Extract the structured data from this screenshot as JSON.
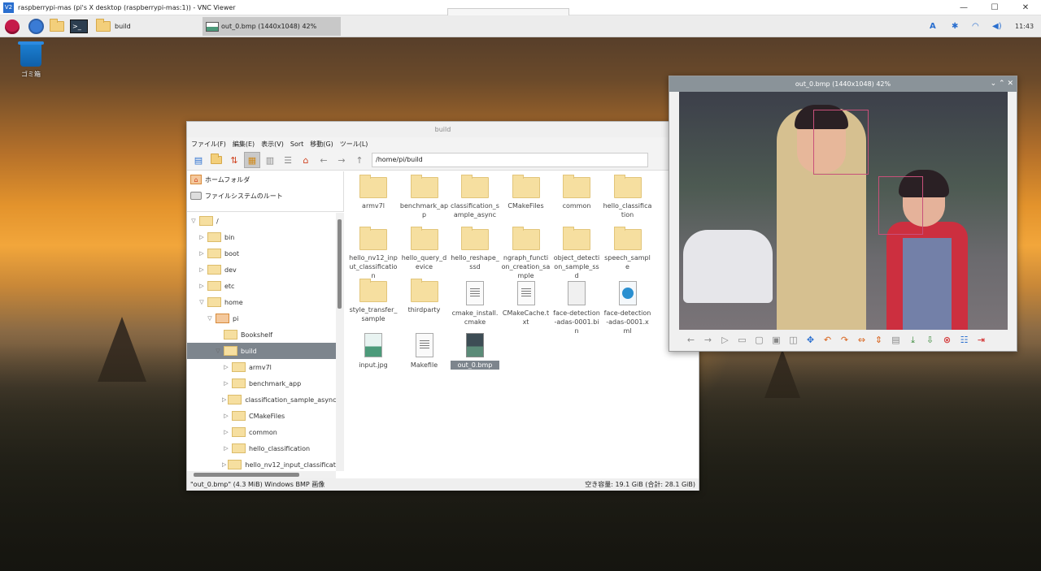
{
  "vnc": {
    "title": "raspberrypi-mas (pi's X desktop (raspberrypi-mas:1)) - VNC Viewer",
    "icon_text": "V2",
    "minimize": "—",
    "maximize": "☐",
    "close": "✕"
  },
  "taskbar": {
    "task_build": "build",
    "task_viewer": "out_0.bmp (1440x1048) 42%",
    "lang": "A",
    "clock": "11:43"
  },
  "desktop": {
    "trash_label": "ゴミ箱"
  },
  "fm": {
    "title": "build",
    "menu": [
      "ファイル(F)",
      "編集(E)",
      "表示(V)",
      "Sort",
      "移動(G)",
      "ツール(L)"
    ],
    "path": "/home/pi/build",
    "places": [
      "ホームフォルダ",
      "ファイルシステムのルート"
    ],
    "tree": [
      {
        "label": "/",
        "expanded": true
      },
      {
        "label": "bin"
      },
      {
        "label": "boot"
      },
      {
        "label": "dev"
      },
      {
        "label": "etc"
      },
      {
        "label": "home",
        "expanded": true
      },
      {
        "label": "pi",
        "expanded": true
      },
      {
        "label": "Bookshelf"
      },
      {
        "label": "build",
        "expanded": true,
        "selected": true
      },
      {
        "label": "armv7l"
      },
      {
        "label": "benchmark_app"
      },
      {
        "label": "classification_sample_async"
      },
      {
        "label": "CMakeFiles"
      },
      {
        "label": "common"
      },
      {
        "label": "hello_classification"
      },
      {
        "label": "hello_nv12_input_classificatic"
      }
    ],
    "files": [
      {
        "name": "armv7l",
        "type": "folder"
      },
      {
        "name": "benchmark_app",
        "type": "folder"
      },
      {
        "name": "classification_sample_async",
        "type": "folder"
      },
      {
        "name": "CMakeFiles",
        "type": "folder"
      },
      {
        "name": "common",
        "type": "folder"
      },
      {
        "name": "hello_classification",
        "type": "folder"
      },
      {
        "name": "hello_nv12_input_classification",
        "type": "folder"
      },
      {
        "name": "hello_query_device",
        "type": "folder"
      },
      {
        "name": "hello_reshape_ssd",
        "type": "folder"
      },
      {
        "name": "ngraph_function_creation_sample",
        "type": "folder"
      },
      {
        "name": "object_detection_sample_ssd",
        "type": "folder"
      },
      {
        "name": "speech_sample",
        "type": "folder"
      },
      {
        "name": "style_transfer_sample",
        "type": "folder"
      },
      {
        "name": "thirdparty",
        "type": "folder"
      },
      {
        "name": "cmake_install.cmake",
        "type": "doc"
      },
      {
        "name": "CMakeCache.txt",
        "type": "doc"
      },
      {
        "name": "face-detection-adas-0001.bin",
        "type": "bin"
      },
      {
        "name": "face-detection-adas-0001.xml",
        "type": "xml"
      },
      {
        "name": "input.jpg",
        "type": "img"
      },
      {
        "name": "Makefile",
        "type": "doc"
      },
      {
        "name": "out_0.bmp",
        "type": "img2",
        "selected": true
      }
    ],
    "status_left": "\"out_0.bmp\" (4.3 MiB) Windows BMP 画像",
    "status_right": "空き容量: 19.1 GiB (合計: 28.1 GiB)"
  },
  "viewer": {
    "title": "out_0.bmp (1440x1048) 42%"
  }
}
